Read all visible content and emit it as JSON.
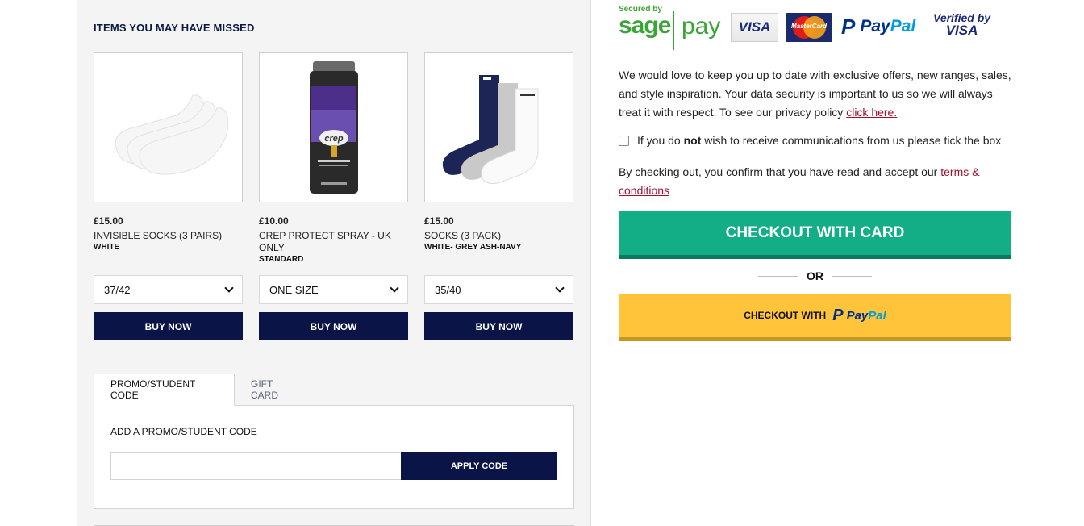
{
  "missed": {
    "title": "ITEMS YOU MAY HAVE MISSED",
    "products": [
      {
        "price": "£15.00",
        "name": "INVISIBLE SOCKS (3 PAIRS)",
        "variant": "WHITE",
        "size": "37/42",
        "buy_label": "BUY NOW"
      },
      {
        "price": "£10.00",
        "name": "CREP PROTECT SPRAY - UK ONLY",
        "variant": "STANDARD",
        "size": "ONE SIZE",
        "buy_label": "BUY NOW"
      },
      {
        "price": "£15.00",
        "name": "SOCKS (3 PACK)",
        "variant": "WHITE- GREY ASH-NAVY",
        "size": "35/40",
        "buy_label": "BUY NOW"
      }
    ]
  },
  "promo": {
    "tabs": [
      "PROMO/STUDENT CODE",
      "GIFT CARD"
    ],
    "label": "ADD A PROMO/STUDENT CODE",
    "input_placeholder": "",
    "apply_label": "APPLY CODE"
  },
  "payment_logos": {
    "secured_by": "Secured by",
    "sage": "sage",
    "sage_pay": "pay",
    "visa": "VISA",
    "mastercard": "MasterCard",
    "paypal_a": "Pay",
    "paypal_b": "Pal",
    "verified_by": "Verified by",
    "verified_visa": "VISA"
  },
  "marketing": {
    "text": "We would love to keep you up to date with exclusive offers, new ranges, sales, and style inspiration. Your data security is important to us so we will always treat it with respect. To see our privacy policy ",
    "link": "click here."
  },
  "optout": {
    "before": "If you do ",
    "bold": "not",
    "after": " wish to receive communications from us please tick the box"
  },
  "terms": {
    "text": "By checking out, you confirm that you have read and accept our ",
    "link": "terms & conditions"
  },
  "checkout": {
    "card_label": "CHECKOUT WITH CARD",
    "or_label": "OR",
    "paypal_prefix": "CHECKOUT WITH",
    "paypal_a": "Pay",
    "paypal_b": "Pal"
  },
  "colors": {
    "navy": "#0b1447",
    "green": "#14ae86",
    "paypal_yellow": "#ffc439",
    "link": "#a0112f"
  }
}
